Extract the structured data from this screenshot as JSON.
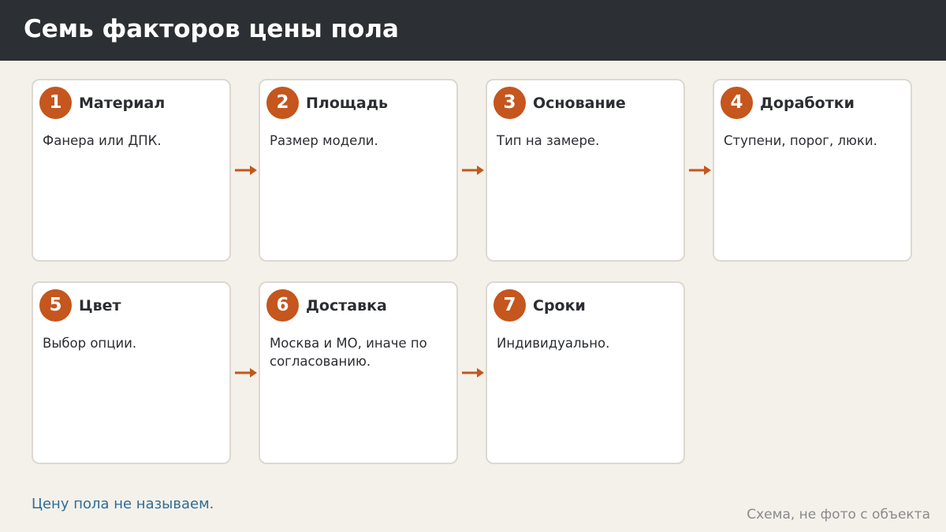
{
  "header": {
    "title": "Семь факторов цены пола"
  },
  "steps": [
    {
      "number": "1",
      "title": "Материал",
      "text": "Фанера или ДПК."
    },
    {
      "number": "2",
      "title": "Площадь",
      "text": "Размер модели."
    },
    {
      "number": "3",
      "title": "Основание",
      "text": "Тип на замере."
    },
    {
      "number": "4",
      "title": "Доработки",
      "text": "Ступени, порог, люки."
    },
    {
      "number": "5",
      "title": "Цвет",
      "text": "Выбор опции."
    },
    {
      "number": "6",
      "title": "Доставка",
      "text": "Москва и МО, иначе по согласованию."
    },
    {
      "number": "7",
      "title": "Сроки",
      "text": "Индивидуально."
    }
  ],
  "footer": {
    "note": "Цену пола не называем.",
    "credit": "Схема, не фото с объекта"
  },
  "colors": {
    "header_bg": "#2c2f34",
    "accent": "#c4561e",
    "background": "#f4f1eb",
    "note_text": "#2f6d95"
  }
}
